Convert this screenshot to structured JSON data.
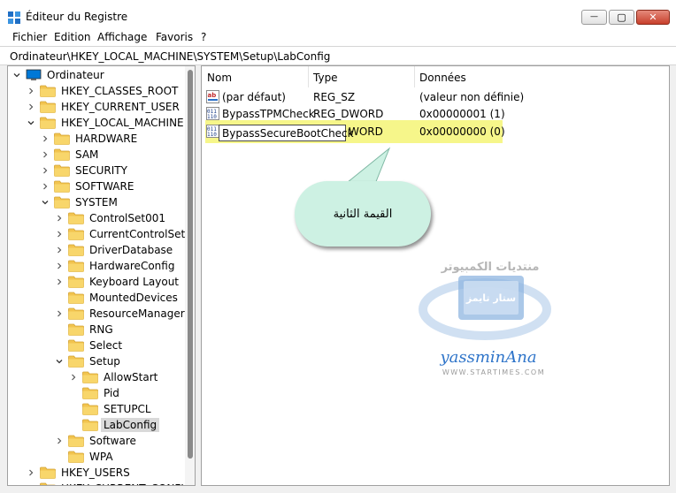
{
  "window": {
    "title": "Éditeur du Registre",
    "min_glyph": "—",
    "max_glyph": "▢",
    "close_glyph": "✕"
  },
  "menu": [
    "Fichier",
    "Edition",
    "Affichage",
    "Favoris",
    "?"
  ],
  "address": "Ordinateur\\HKEY_LOCAL_MACHINE\\SYSTEM\\Setup\\LabConfig",
  "tree": [
    {
      "label": "Ordinateur",
      "level": 0,
      "expanded": true,
      "type": "computer"
    },
    {
      "label": "HKEY_CLASSES_ROOT",
      "level": 1,
      "expanded": false
    },
    {
      "label": "HKEY_CURRENT_USER",
      "level": 1,
      "expanded": false
    },
    {
      "label": "HKEY_LOCAL_MACHINE",
      "level": 1,
      "expanded": true
    },
    {
      "label": "HARDWARE",
      "level": 2,
      "expanded": false
    },
    {
      "label": "SAM",
      "level": 2,
      "expanded": false
    },
    {
      "label": "SECURITY",
      "level": 2,
      "expanded": false
    },
    {
      "label": "SOFTWARE",
      "level": 2,
      "expanded": false
    },
    {
      "label": "SYSTEM",
      "level": 2,
      "expanded": true
    },
    {
      "label": "ControlSet001",
      "level": 3,
      "expanded": false
    },
    {
      "label": "CurrentControlSet",
      "level": 3,
      "expanded": false
    },
    {
      "label": "DriverDatabase",
      "level": 3,
      "expanded": false
    },
    {
      "label": "HardwareConfig",
      "level": 3,
      "expanded": false
    },
    {
      "label": "Keyboard Layout",
      "level": 3,
      "expanded": false
    },
    {
      "label": "MountedDevices",
      "level": 3,
      "leaf": true
    },
    {
      "label": "ResourceManager",
      "level": 3,
      "expanded": false
    },
    {
      "label": "RNG",
      "level": 3,
      "leaf": true
    },
    {
      "label": "Select",
      "level": 3,
      "leaf": true
    },
    {
      "label": "Setup",
      "level": 3,
      "expanded": true
    },
    {
      "label": "AllowStart",
      "level": 4,
      "expanded": false
    },
    {
      "label": "Pid",
      "level": 4,
      "leaf": true
    },
    {
      "label": "SETUPCL",
      "level": 4,
      "leaf": true
    },
    {
      "label": "LabConfig",
      "level": 4,
      "leaf": true,
      "selected": true
    },
    {
      "label": "Software",
      "level": 3,
      "expanded": false
    },
    {
      "label": "WPA",
      "level": 3,
      "leaf": true
    },
    {
      "label": "HKEY_USERS",
      "level": 1,
      "expanded": false
    },
    {
      "label": "HKEY_CURRENT_CONFIG",
      "level": 1,
      "expanded": false
    }
  ],
  "list": {
    "columns": [
      "Nom",
      "Type",
      "Données"
    ],
    "rows": [
      {
        "name": "(par défaut)",
        "type": "REG_SZ",
        "data": "(valeur non définie)",
        "icon": "string-value-icon"
      },
      {
        "name": "BypassTPMCheck",
        "type": "REG_DWORD",
        "data": "0x00000001 (1)",
        "icon": "binary-value-icon"
      },
      {
        "name": "BypassSecureBootCheck",
        "type": "WORD",
        "data": "0x00000000 (0)",
        "icon": "binary-value-icon",
        "editing": true
      }
    ]
  },
  "callout": {
    "text": "القيمة الثانية",
    "fill": "#cdf1e3"
  },
  "watermark": {
    "top_text": "منتديات الكمبيوتر",
    "badge_text": "ستار تايمز",
    "brand": "yassminAna",
    "url": "WWW.STARTIMES.COM"
  },
  "colors": {
    "highlight": "#f6f68a",
    "folder": "#f2c44f",
    "accent": "#0078d7"
  }
}
